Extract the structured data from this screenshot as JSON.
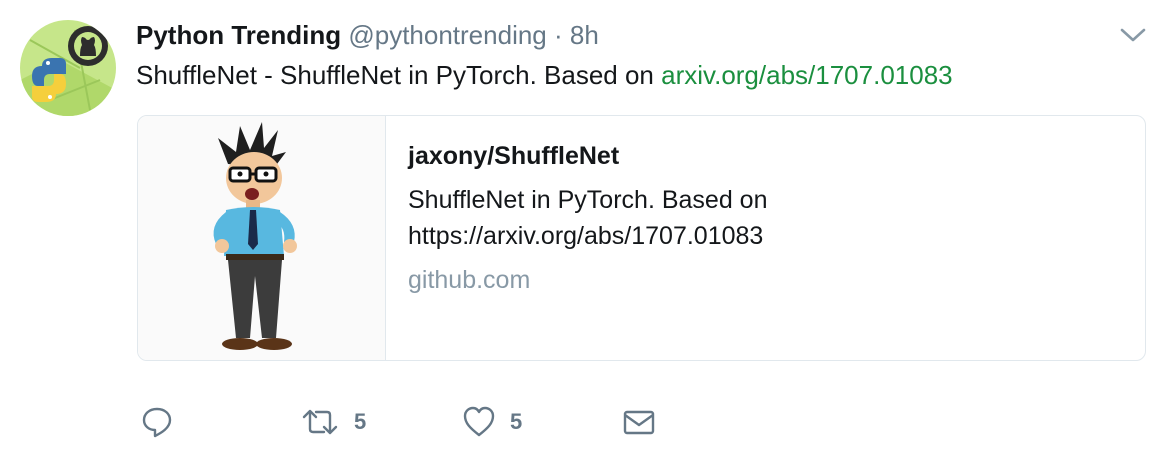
{
  "tweet": {
    "display_name": "Python Trending",
    "handle": "@pythontrending",
    "separator": "·",
    "time": "8h",
    "text_prefix": "ShuffleNet - ShuffleNet in PyTorch. Based on ",
    "text_link": "arxiv.org/abs/1707.01083"
  },
  "card": {
    "title": "jaxony/ShuffleNet",
    "description": "ShuffleNet in PyTorch. Based on https://arxiv.org/abs/1707.01083",
    "domain": "github.com"
  },
  "actions": {
    "reply_count": "",
    "retweet_count": "5",
    "like_count": "5"
  },
  "icons": {
    "avatar": "python-github-avatar-icon",
    "caret": "chevron-down-icon",
    "reply": "reply-icon",
    "retweet": "retweet-icon",
    "like": "heart-icon",
    "dm": "envelope-icon"
  },
  "colors": {
    "link": "#1b8f3f",
    "muted": "#657786",
    "border": "#e1e8ed"
  }
}
